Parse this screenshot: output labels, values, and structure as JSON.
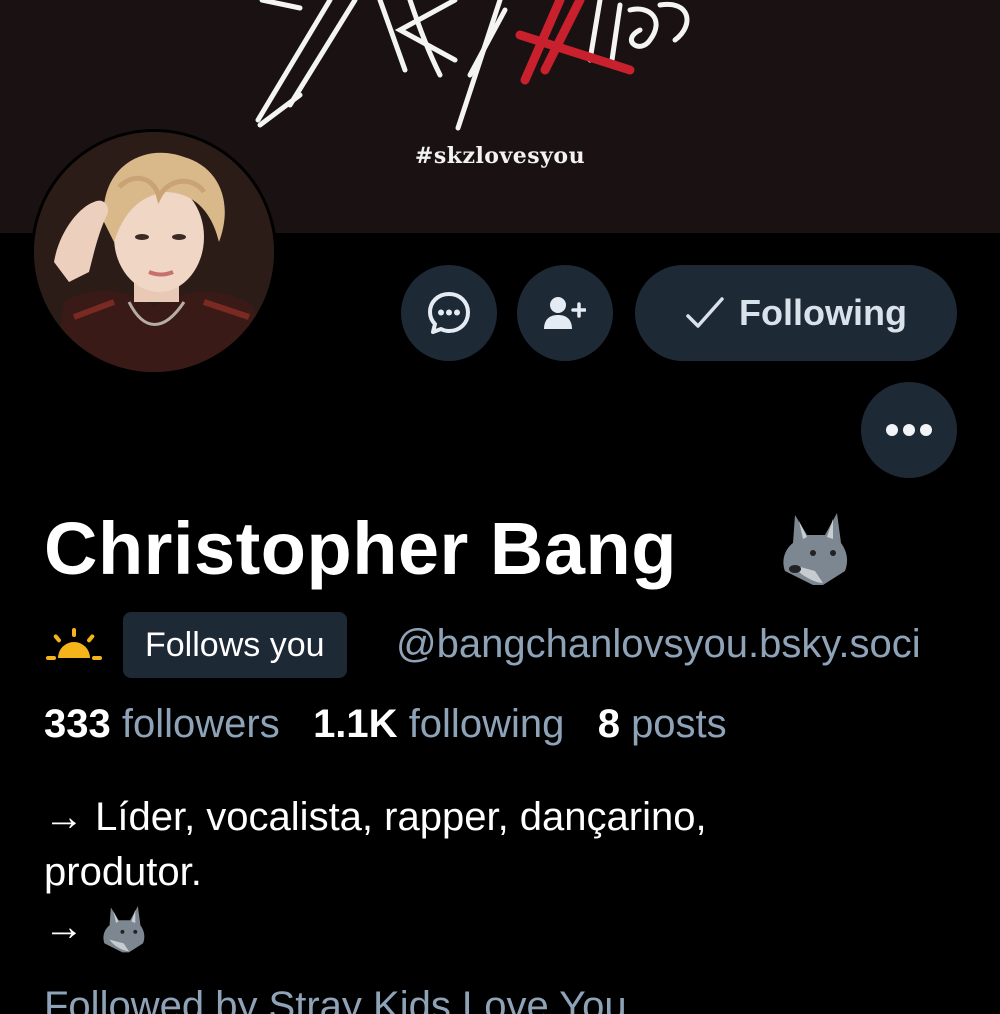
{
  "banner": {
    "hashtag": "#skzlovesyou",
    "logo_text": "Stray Kids"
  },
  "profile": {
    "display_name": "Christopher Bang",
    "name_emoji": "wolf-emoji",
    "status_emoji": "sunrise-emoji",
    "follows_you_badge": "Follows you",
    "handle": "@bangchanlovsyou.bsky.soci",
    "stats": {
      "followers_count": "333",
      "followers_label": "followers",
      "following_count": "1.1K",
      "following_label": "following",
      "posts_count": "8",
      "posts_label": "posts"
    },
    "bio": {
      "line1": "→ Líder, vocalista, rapper, dançarino,",
      "line2": "produtor.",
      "line3_arrow": "→"
    },
    "followed_by_partial": "Followed by Stray Kids Love You"
  },
  "actions": {
    "message_icon": "chat-bubble-icon",
    "add_user_icon": "user-plus-icon",
    "following_label": "Following",
    "following_icon": "check-icon",
    "more_icon": "ellipsis-icon"
  },
  "colors": {
    "background": "#000000",
    "button_bg": "#1e2936",
    "muted_text": "#8fa3b8",
    "banner_bg": "#1a1212",
    "accent_red": "#c8202c"
  }
}
